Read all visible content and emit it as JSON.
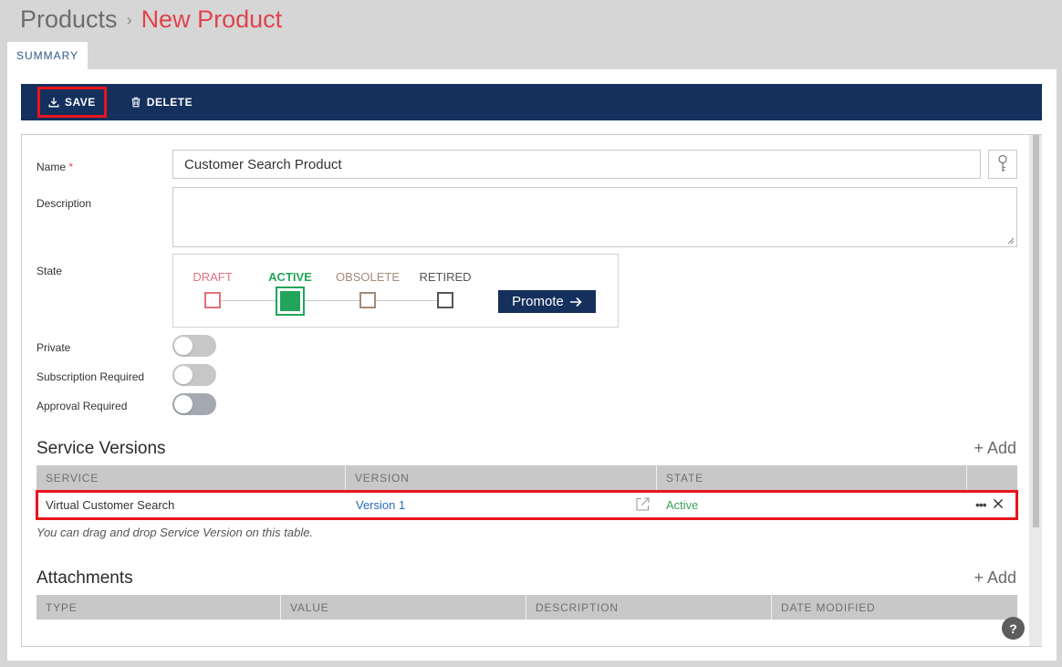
{
  "breadcrumb": {
    "root": "Products",
    "separator": "›",
    "current": "New Product"
  },
  "tabs": [
    {
      "label": "SUMMARY"
    }
  ],
  "toolbar": {
    "save_label": "SAVE",
    "delete_label": "DELETE"
  },
  "form": {
    "name_label": "Name",
    "required_mark": "*",
    "name_value": "Customer Search Product",
    "description_label": "Description",
    "description_value": "",
    "state_label": "State",
    "states": [
      {
        "label": "DRAFT",
        "color": "#e2707a"
      },
      {
        "label": "ACTIVE",
        "color": "#22a55a"
      },
      {
        "label": "OBSOLETE",
        "color": "#a38b78"
      },
      {
        "label": "RETIRED",
        "color": "#555555"
      }
    ],
    "current_state": "ACTIVE",
    "promote_label": "Promote",
    "toggles": [
      {
        "label": "Private",
        "on": false
      },
      {
        "label": "Subscription Required",
        "on": false
      },
      {
        "label": "Approval Required",
        "on": false
      }
    ]
  },
  "service_versions": {
    "title": "Service Versions",
    "add_label": "+ Add",
    "columns": [
      "SERVICE",
      "VERSION",
      "STATE",
      ""
    ],
    "rows": [
      {
        "service": "Virtual Customer Search",
        "version": "Version 1",
        "state": "Active"
      }
    ],
    "hint": "You can drag and drop Service Version on this table."
  },
  "attachments": {
    "title": "Attachments",
    "add_label": "+ Add",
    "columns": [
      "TYPE",
      "VALUE",
      "DESCRIPTION",
      "DATE MODIFIED"
    ]
  },
  "help_label": "?",
  "colors": {
    "accent": "#15305c",
    "danger": "#e0434c",
    "success": "#22a55a",
    "link": "#2a6ab6"
  }
}
